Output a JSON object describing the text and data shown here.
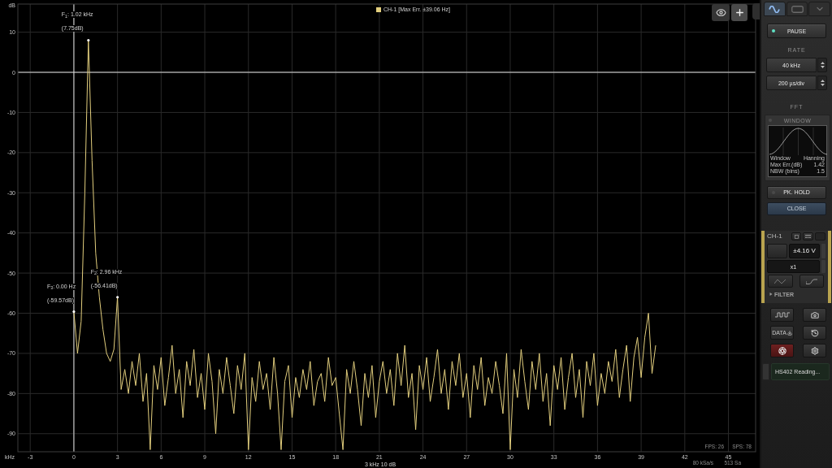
{
  "chart": {
    "chart_data": {
      "type": "line",
      "xlabel": "kHz",
      "ylabel": "dB",
      "grid": true,
      "x": [
        0,
        0.25,
        0.5,
        0.75,
        1,
        1.25,
        1.5,
        1.75,
        2,
        2.25,
        2.5,
        2.75,
        3,
        3.25,
        3.5,
        3.75,
        4,
        4.25,
        4.5,
        4.75,
        5,
        5.25,
        5.5,
        5.75,
        6,
        6.25,
        6.5,
        6.75,
        7,
        7.25,
        7.5,
        7.75,
        8,
        8.25,
        8.5,
        8.75,
        9,
        9.25,
        9.5,
        9.75,
        10,
        10.25,
        10.5,
        10.75,
        11,
        11.25,
        11.5,
        11.75,
        12,
        12.25,
        12.5,
        12.75,
        13,
        13.25,
        13.5,
        13.75,
        14,
        14.25,
        14.5,
        14.75,
        15,
        15.25,
        15.5,
        15.75,
        16,
        16.25,
        16.5,
        16.75,
        17,
        17.25,
        17.5,
        17.75,
        18,
        18.25,
        18.5,
        18.75,
        19,
        19.25,
        19.5,
        19.75,
        20,
        20.25,
        20.5,
        20.75,
        21,
        21.25,
        21.5,
        21.75,
        22,
        22.25,
        22.5,
        22.75,
        23,
        23.25,
        23.5,
        23.75,
        24,
        24.25,
        24.5,
        24.75,
        25,
        25.25,
        25.5,
        25.75,
        26,
        26.25,
        26.5,
        26.75,
        27,
        27.25,
        27.5,
        27.75,
        28,
        28.25,
        28.5,
        28.75,
        29,
        29.25,
        29.5,
        29.75,
        30,
        30.25,
        30.5,
        30.75,
        31,
        31.25,
        31.5,
        31.75,
        32,
        32.25,
        32.5,
        32.75,
        33,
        33.25,
        33.5,
        33.75,
        34,
        34.25,
        34.5,
        34.75,
        35,
        35.25,
        35.5,
        35.75,
        36,
        36.25,
        36.5,
        36.75,
        37,
        37.25,
        37.5,
        37.75,
        38,
        38.25,
        38.5,
        38.75,
        39,
        39.25,
        39.5,
        39.75,
        40
      ],
      "series": [
        {
          "name": "CH-1 [Max Err. ±39.06 Hz]",
          "color": "#e3cf7e",
          "values": [
            -59.6,
            -70,
            -62,
            -30,
            8,
            -22,
            -45,
            -56,
            -64,
            -70,
            -72,
            -69,
            -56,
            -79,
            -74,
            -80,
            -72,
            -78,
            -70,
            -82,
            -75,
            -94,
            -73,
            -79,
            -71,
            -83,
            -76,
            -68,
            -80,
            -74,
            -86,
            -72,
            -78,
            -69,
            -81,
            -75,
            -84,
            -70,
            -77,
            -90,
            -74,
            -80,
            -71,
            -78,
            -85,
            -73,
            -79,
            -70,
            -94,
            -76,
            -82,
            -72,
            -79,
            -75,
            -84,
            -71,
            -80,
            -94,
            -77,
            -73,
            -86,
            -76,
            -81,
            -74,
            -79,
            -72,
            -83,
            -77,
            -75,
            -82,
            -71,
            -78,
            -76,
            -85,
            -94,
            -74,
            -80,
            -72,
            -79,
            -88,
            -75,
            -81,
            -73,
            -86,
            -77,
            -72,
            -80,
            -74,
            -83,
            -70,
            -78,
            -68,
            -81,
            -75,
            -89,
            -73,
            -79,
            -71,
            -82,
            -76,
            -69,
            -80,
            -74,
            -84,
            -72,
            -78,
            -70,
            -81,
            -75,
            -86,
            -73,
            -79,
            -71,
            -83,
            -76,
            -80,
            -72,
            -78,
            -85,
            -70,
            -94,
            -74,
            -81,
            -69,
            -77,
            -84,
            -72,
            -79,
            -70,
            -82,
            -75,
            -88,
            -73,
            -79,
            -71,
            -84,
            -76,
            -70,
            -81,
            -74,
            -86,
            -72,
            -78,
            -70,
            -83,
            -75,
            -80,
            -72,
            -77,
            -69,
            -81,
            -74,
            -68,
            -82,
            -71,
            -66,
            -76,
            -66,
            -60,
            -75,
            -68
          ]
        }
      ],
      "xlim": [
        -3.85,
        46.87
      ],
      "ylim": [
        -94.5,
        17
      ],
      "xticks": [
        -3,
        0,
        3,
        6,
        9,
        12,
        15,
        18,
        21,
        24,
        27,
        30,
        33,
        36,
        39,
        42,
        45
      ],
      "yticks": [
        10,
        0,
        -10,
        -20,
        -30,
        -40,
        -50,
        -60,
        -70,
        -80,
        -90
      ],
      "annotations": [
        "F$_{1}$: 1.02 kHz",
        "(7.75dB)",
        "F$_{2}$: 2.96 kHz",
        "(-56.41dB)",
        "F$_{3}$: 0.00 Hz",
        "(-59.57dB)"
      ]
    },
    "scale_label": "3 kHz 10 dB",
    "fps": "FPS: 26",
    "sps": "SPS: 78",
    "sample_rate": "80 kSa/s",
    "sample_count": "513 Sa"
  },
  "panel": {
    "tabs": [
      {
        "kind": "wave",
        "selected": true
      },
      {
        "kind": "screen",
        "selected": false
      },
      {
        "kind": "chevron",
        "selected": false
      }
    ],
    "pause": {
      "label": "PAUSE",
      "on": true
    },
    "rate_heading": "RATE",
    "sample_rate": "40 kHz",
    "time_base": "200 µs/div",
    "fft_heading": "FFT",
    "window": {
      "heading": "WINDOW",
      "rows": [
        {
          "label": "Window",
          "value": "Hanning"
        },
        {
          "label": "Max Err.(dB)",
          "value": "1.42"
        },
        {
          "label": "NBW (bins)",
          "value": "1.5"
        }
      ]
    },
    "pk_hold": {
      "label": "PK. HOLD",
      "on": false
    },
    "close": "CLOSE",
    "channel": {
      "name": "CH-1",
      "range": "±4.16 V",
      "probe": "x1",
      "filter": {
        "label": "FILTER",
        "expanded": false
      }
    },
    "actions": [
      {
        "kind": "wave",
        "active": false
      },
      {
        "kind": "camera",
        "active": false
      },
      {
        "kind": "data",
        "label": "DATA",
        "active": false
      },
      {
        "kind": "history",
        "active": false
      },
      {
        "kind": "alert",
        "active": true
      },
      {
        "kind": "settings",
        "active": false
      }
    ],
    "status": "HS402 Reading..."
  }
}
